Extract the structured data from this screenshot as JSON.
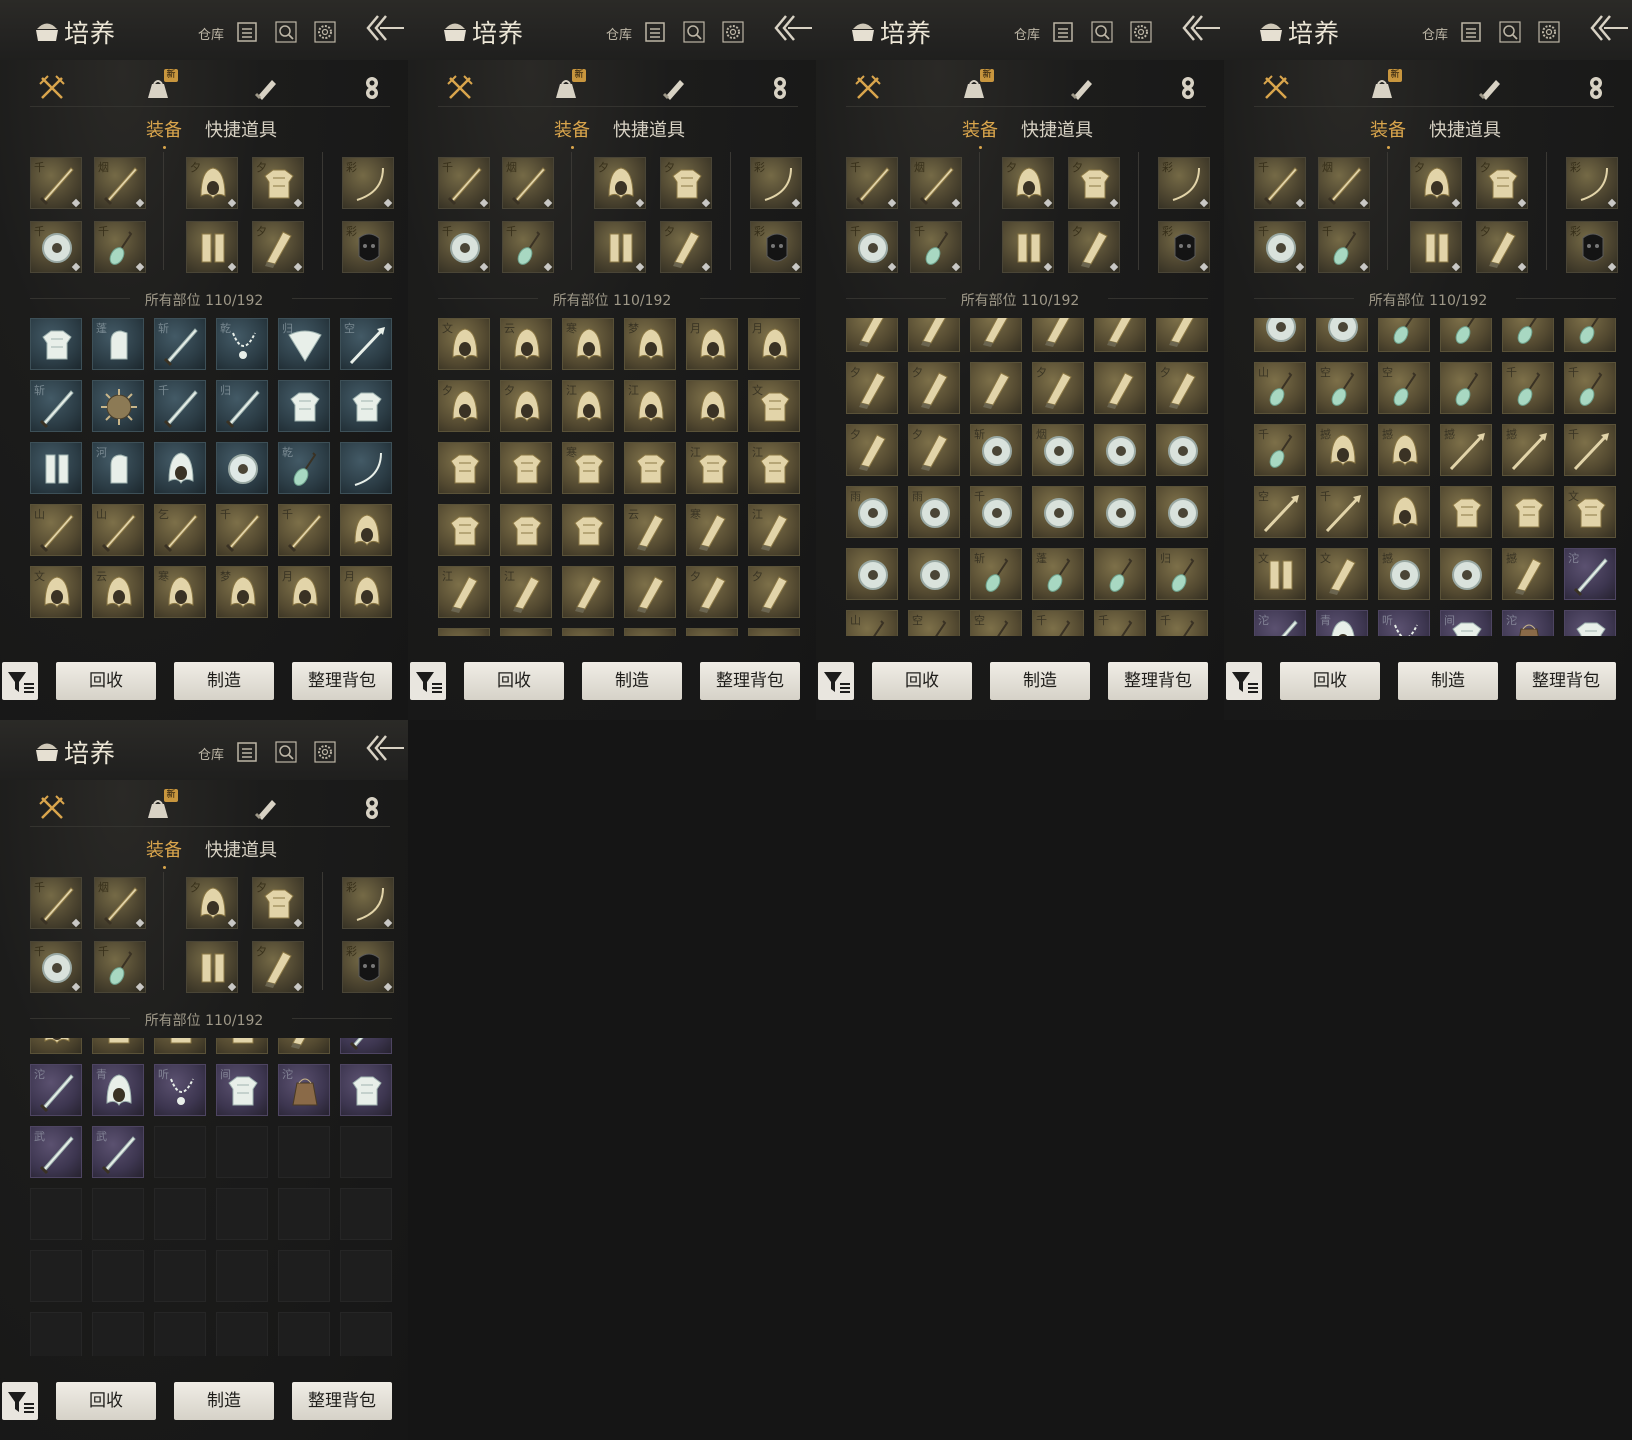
{
  "header": {
    "title": "培养",
    "warehouse_label": "仓库",
    "icons": [
      "list-icon",
      "search-icon",
      "gear-icon",
      "back-arrow-icon"
    ]
  },
  "categories": [
    {
      "name": "weapon",
      "icon": "crossed-swords-icon",
      "active": true
    },
    {
      "name": "items",
      "icon": "pouch-icon",
      "badge": "新"
    },
    {
      "name": "scroll",
      "icon": "scroll-icon"
    },
    {
      "name": "currency",
      "icon": "coin-stack-icon"
    }
  ],
  "subtabs": {
    "equipment": "装备",
    "quick_items": "快捷道具"
  },
  "count": {
    "label": "所有部位",
    "value": "110/192"
  },
  "buttons": {
    "recycle": "回收",
    "craft": "制造",
    "sort": "整理背包"
  },
  "colors": {
    "accent": "#d9a54c",
    "button_bg": "#e9e6df"
  },
  "equipped": [
    [
      {
        "mark": "千",
        "icon": "blade-icon"
      },
      {
        "mark": "烟",
        "icon": "blade-icon"
      },
      {
        "mark": "夕",
        "icon": "helmet-icon"
      },
      {
        "mark": "夕",
        "icon": "armor-icon"
      },
      {
        "mark": "彩",
        "icon": "bow-icon"
      }
    ],
    [
      {
        "mark": "千",
        "icon": "ring-icon"
      },
      {
        "mark": "千",
        "icon": "tassel-icon"
      },
      {
        "mark": "",
        "icon": "gloves-icon"
      },
      {
        "mark": "夕",
        "icon": "leg-armor-icon"
      },
      {
        "mark": "彩",
        "icon": "mask-icon"
      }
    ]
  ],
  "panels": [
    {
      "offset": 0,
      "rows": [
        [
          [
            "teal",
            "",
            "armor"
          ],
          [
            "teal",
            "蓬",
            "glove"
          ],
          [
            "teal",
            "斩",
            "sword"
          ],
          [
            "teal",
            "乾",
            "chain"
          ],
          [
            "teal",
            "归",
            "fan"
          ],
          [
            "teal",
            "空",
            "spear"
          ]
        ],
        [
          [
            "teal",
            "斩",
            "sword"
          ],
          [
            "teal",
            "",
            "spiky"
          ],
          [
            "teal",
            "千",
            "sword"
          ],
          [
            "teal",
            "归",
            "sword"
          ],
          [
            "teal",
            "",
            "armor"
          ],
          [
            "teal",
            "",
            "armor"
          ]
        ],
        [
          [
            "teal",
            "",
            "legs"
          ],
          [
            "teal",
            "河",
            "glove"
          ],
          [
            "teal",
            "",
            "helm"
          ],
          [
            "teal",
            "",
            "ring"
          ],
          [
            "teal",
            "乾",
            "tassel"
          ],
          [
            "teal",
            "",
            "bow"
          ]
        ],
        [
          [
            "gold",
            "山",
            "blade"
          ],
          [
            "gold",
            "山",
            "blade"
          ],
          [
            "gold",
            "乞",
            "blade"
          ],
          [
            "gold",
            "千",
            "blade"
          ],
          [
            "gold",
            "千",
            "blade"
          ],
          [
            "gold",
            "",
            "helm"
          ]
        ],
        [
          [
            "gold",
            "文",
            "helm"
          ],
          [
            "gold",
            "云",
            "helm"
          ],
          [
            "gold",
            "寒",
            "helm"
          ],
          [
            "gold",
            "梦",
            "helm"
          ],
          [
            "gold",
            "月",
            "helm"
          ],
          [
            "gold",
            "月",
            "helm"
          ]
        ]
      ]
    },
    {
      "offset": 0,
      "rows": [
        [
          [
            "gold",
            "文",
            "helm"
          ],
          [
            "gold",
            "云",
            "helm"
          ],
          [
            "gold",
            "寒",
            "helm"
          ],
          [
            "gold",
            "梦",
            "helm"
          ],
          [
            "gold",
            "月",
            "helm"
          ],
          [
            "gold",
            "月",
            "helm"
          ]
        ],
        [
          [
            "gold",
            "夕",
            "helm"
          ],
          [
            "gold",
            "夕",
            "helm"
          ],
          [
            "gold",
            "江",
            "helm"
          ],
          [
            "gold",
            "江",
            "helm"
          ],
          [
            "gold",
            "",
            "helm"
          ],
          [
            "gold",
            "文",
            "armor"
          ]
        ],
        [
          [
            "gold",
            "",
            "armor"
          ],
          [
            "gold",
            "",
            "armor"
          ],
          [
            "gold",
            "寒",
            "armor"
          ],
          [
            "gold",
            "",
            "armor"
          ],
          [
            "gold",
            "江",
            "armor"
          ],
          [
            "gold",
            "江",
            "armor"
          ]
        ],
        [
          [
            "gold",
            "",
            "armor"
          ],
          [
            "gold",
            "",
            "armor"
          ],
          [
            "gold",
            "",
            "armor"
          ],
          [
            "gold",
            "云",
            "leg"
          ],
          [
            "gold",
            "寒",
            "leg"
          ],
          [
            "gold",
            "江",
            "leg"
          ]
        ],
        [
          [
            "gold",
            "江",
            "leg"
          ],
          [
            "gold",
            "江",
            "leg"
          ],
          [
            "gold",
            "",
            "leg"
          ],
          [
            "gold",
            "",
            "leg"
          ],
          [
            "gold",
            "夕",
            "leg"
          ],
          [
            "gold",
            "夕",
            "leg"
          ]
        ],
        [
          [
            "gold",
            "",
            "leg"
          ],
          [
            "gold",
            "",
            "leg"
          ],
          [
            "gold",
            "",
            "leg"
          ],
          [
            "gold",
            "",
            "leg"
          ],
          [
            "gold",
            "",
            "leg"
          ],
          [
            "gold",
            "",
            "leg"
          ]
        ]
      ]
    },
    {
      "offset": -18,
      "rows": [
        [
          [
            "gold",
            "",
            "leg"
          ],
          [
            "gold",
            "",
            "leg"
          ],
          [
            "gold",
            "",
            "leg"
          ],
          [
            "gold",
            "",
            "leg"
          ],
          [
            "gold",
            "",
            "leg"
          ],
          [
            "gold",
            "",
            "leg"
          ]
        ],
        [
          [
            "gold",
            "夕",
            "leg"
          ],
          [
            "gold",
            "夕",
            "leg"
          ],
          [
            "gold",
            "",
            "leg"
          ],
          [
            "gold",
            "夕",
            "leg"
          ],
          [
            "gold",
            "",
            "leg"
          ],
          [
            "gold",
            "夕",
            "leg"
          ]
        ],
        [
          [
            "gold",
            "夕",
            "leg"
          ],
          [
            "gold",
            "夕",
            "leg"
          ],
          [
            "gold",
            "斩",
            "ring"
          ],
          [
            "gold",
            "烟",
            "ring"
          ],
          [
            "gold",
            "",
            "ring"
          ],
          [
            "gold",
            "",
            "ring"
          ]
        ],
        [
          [
            "gold",
            "雨",
            "ring"
          ],
          [
            "gold",
            "雨",
            "ring"
          ],
          [
            "gold",
            "千",
            "ring"
          ],
          [
            "gold",
            "",
            "ring"
          ],
          [
            "gold",
            "",
            "ring"
          ],
          [
            "gold",
            "",
            "ring"
          ]
        ],
        [
          [
            "gold",
            "",
            "ring"
          ],
          [
            "gold",
            "",
            "ring"
          ],
          [
            "gold",
            "斩",
            "tassel"
          ],
          [
            "gold",
            "蓬",
            "tassel"
          ],
          [
            "gold",
            "",
            "tassel"
          ],
          [
            "gold",
            "归",
            "tassel"
          ]
        ],
        [
          [
            "gold",
            "山",
            "tassel"
          ],
          [
            "gold",
            "空",
            "tassel"
          ],
          [
            "gold",
            "空",
            "tassel"
          ],
          [
            "gold",
            "千",
            "tassel"
          ],
          [
            "gold",
            "千",
            "tassel"
          ],
          [
            "gold",
            "千",
            "tassel"
          ]
        ]
      ]
    },
    {
      "offset": -18,
      "rows": [
        [
          [
            "gold",
            "",
            "ring"
          ],
          [
            "gold",
            "",
            "ring"
          ],
          [
            "gold",
            "",
            "tassel"
          ],
          [
            "gold",
            "",
            "tassel"
          ],
          [
            "gold",
            "",
            "tassel"
          ],
          [
            "gold",
            "",
            "tassel"
          ]
        ],
        [
          [
            "gold",
            "山",
            "tassel"
          ],
          [
            "gold",
            "空",
            "tassel"
          ],
          [
            "gold",
            "空",
            "tassel"
          ],
          [
            "gold",
            "",
            "tassel"
          ],
          [
            "gold",
            "千",
            "tassel"
          ],
          [
            "gold",
            "千",
            "tassel"
          ]
        ],
        [
          [
            "gold",
            "千",
            "tassel"
          ],
          [
            "gold",
            "撼",
            "helm"
          ],
          [
            "gold",
            "撼",
            "helm"
          ],
          [
            "gold",
            "撼",
            "spear"
          ],
          [
            "gold",
            "撼",
            "spear"
          ],
          [
            "gold",
            "千",
            "spear"
          ]
        ],
        [
          [
            "gold",
            "空",
            "spear"
          ],
          [
            "gold",
            "千",
            "spear"
          ],
          [
            "gold",
            "",
            "helm"
          ],
          [
            "gold",
            "",
            "armor"
          ],
          [
            "gold",
            "",
            "armor"
          ],
          [
            "gold",
            "文",
            "armor"
          ]
        ],
        [
          [
            "gold",
            "文",
            "legs"
          ],
          [
            "gold",
            "文",
            "leg"
          ],
          [
            "gold",
            "撼",
            "ring"
          ],
          [
            "gold",
            "",
            "ring"
          ],
          [
            "gold",
            "撼",
            "leg"
          ],
          [
            "purple",
            "沱",
            "sword"
          ]
        ],
        [
          [
            "purple",
            "沱",
            "sword"
          ],
          [
            "purple",
            "青",
            "helm"
          ],
          [
            "purple",
            "听",
            "chain"
          ],
          [
            "purple",
            "间",
            "armor"
          ],
          [
            "purple",
            "沱",
            "pouch"
          ],
          [
            "purple",
            "",
            "armor"
          ]
        ]
      ]
    },
    {
      "offset": -36,
      "rows": [
        [
          [
            "gold",
            "",
            "helm"
          ],
          [
            "gold",
            "",
            "armor"
          ],
          [
            "gold",
            "",
            "armor"
          ],
          [
            "gold",
            "",
            "armor"
          ],
          [
            "gold",
            "",
            "leg"
          ],
          [
            "purple",
            "",
            "sword"
          ]
        ],
        [
          [
            "purple",
            "沱",
            "sword"
          ],
          [
            "purple",
            "青",
            "helm"
          ],
          [
            "purple",
            "听",
            "chain"
          ],
          [
            "purple",
            "间",
            "armor"
          ],
          [
            "purple",
            "沱",
            "pouch"
          ],
          [
            "purple",
            "",
            "armor"
          ]
        ],
        [
          [
            "purple",
            "武",
            "sword"
          ],
          [
            "purple",
            "武",
            "sword"
          ],
          [
            "empty",
            "",
            ""
          ],
          [
            "empty",
            "",
            ""
          ],
          [
            "empty",
            "",
            ""
          ],
          [
            "empty",
            "",
            ""
          ]
        ],
        [
          [
            "empty",
            "",
            ""
          ],
          [
            "empty",
            "",
            ""
          ],
          [
            "empty",
            "",
            ""
          ],
          [
            "empty",
            "",
            ""
          ],
          [
            "empty",
            "",
            ""
          ],
          [
            "empty",
            "",
            ""
          ]
        ],
        [
          [
            "empty",
            "",
            ""
          ],
          [
            "empty",
            "",
            ""
          ],
          [
            "empty",
            "",
            ""
          ],
          [
            "empty",
            "",
            ""
          ],
          [
            "empty",
            "",
            ""
          ],
          [
            "empty",
            "",
            ""
          ]
        ],
        [
          [
            "empty",
            "",
            ""
          ],
          [
            "empty",
            "",
            ""
          ],
          [
            "empty",
            "",
            ""
          ],
          [
            "empty",
            "",
            ""
          ],
          [
            "empty",
            "",
            ""
          ],
          [
            "empty",
            "",
            ""
          ]
        ]
      ]
    }
  ]
}
